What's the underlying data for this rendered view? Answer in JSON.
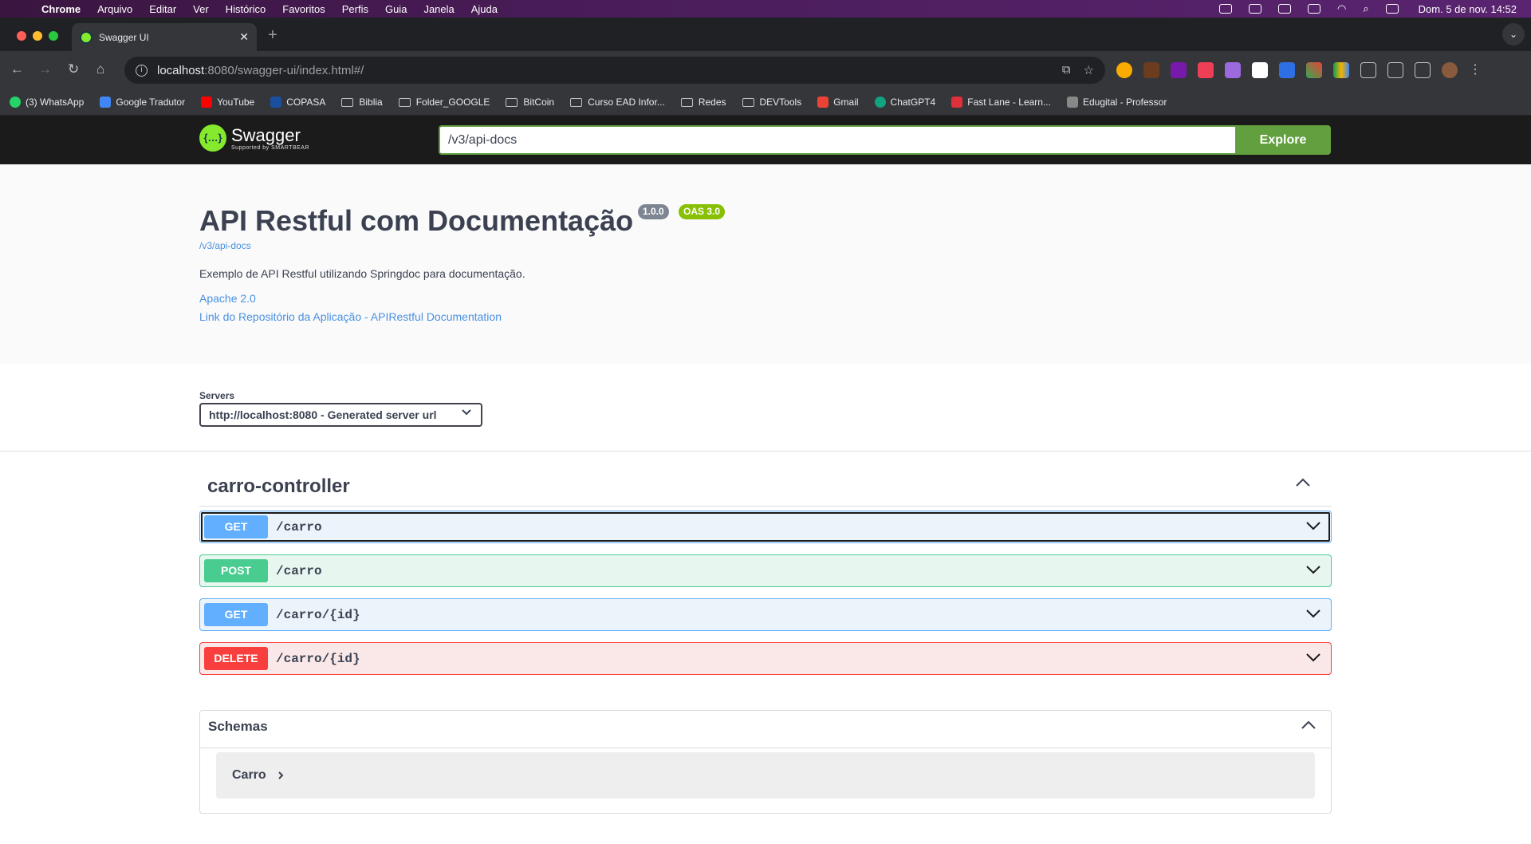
{
  "menubar": {
    "app": "Chrome",
    "items": [
      "Arquivo",
      "Editar",
      "Ver",
      "Histórico",
      "Favoritos",
      "Perfis",
      "Guia",
      "Janela",
      "Ajuda"
    ],
    "clock": "Dom. 5 de nov.  14:52"
  },
  "browser": {
    "tab_title": "Swagger UI",
    "url_host": "localhost",
    "url_path": ":8080/swagger-ui/index.html#/"
  },
  "bookmarks": [
    {
      "label": "(3) WhatsApp",
      "icon": "whatsapp-icon",
      "color": "#25d366"
    },
    {
      "label": "Google Tradutor",
      "icon": "translate-icon",
      "color": "#4285f4"
    },
    {
      "label": "YouTube",
      "icon": "youtube-icon",
      "color": "#ff0000"
    },
    {
      "label": "COPASA",
      "icon": "copasa-icon",
      "color": "#1a4fa0"
    },
    {
      "label": "Biblia",
      "icon": "folder-icon"
    },
    {
      "label": "Folder_GOOGLE",
      "icon": "folder-icon"
    },
    {
      "label": "BitCoin",
      "icon": "folder-icon"
    },
    {
      "label": "Curso EAD Infor...",
      "icon": "folder-icon"
    },
    {
      "label": "Redes",
      "icon": "folder-icon"
    },
    {
      "label": "DEVTools",
      "icon": "folder-icon"
    },
    {
      "label": "Gmail",
      "icon": "gmail-icon",
      "color": "#ea4335"
    },
    {
      "label": "ChatGPT4",
      "icon": "chatgpt-icon",
      "color": "#10a37f"
    },
    {
      "label": "Fast Lane - Learn...",
      "icon": "fastlane-icon",
      "color": "#e0303a"
    },
    {
      "label": "Edugital - Professor",
      "icon": "edugital-icon",
      "color": "#888888"
    }
  ],
  "swagger": {
    "logo_name": "Swagger",
    "logo_sub": "Supported by SMARTBEAR",
    "spec_input": "/v3/api-docs",
    "explore_label": "Explore"
  },
  "info": {
    "title": "API Restful com Documentação",
    "version": "1.0.0",
    "oas": "OAS 3.0",
    "spec_url": "/v3/api-docs",
    "description": "Exemplo de API Restful utilizando Springdoc para documentação.",
    "license": "Apache 2.0",
    "repo_link": "Link do Repositório da Aplicação - APIRestful Documentation"
  },
  "servers": {
    "label": "Servers",
    "selected": "http://localhost:8080 - Generated server url"
  },
  "tag": {
    "name": "carro-controller",
    "operations": [
      {
        "method": "GET",
        "path": "/carro"
      },
      {
        "method": "POST",
        "path": "/carro"
      },
      {
        "method": "GET",
        "path": "/carro/{id}"
      },
      {
        "method": "DELETE",
        "path": "/carro/{id}"
      }
    ]
  },
  "schemas": {
    "title": "Schemas",
    "items": [
      "Carro"
    ]
  }
}
